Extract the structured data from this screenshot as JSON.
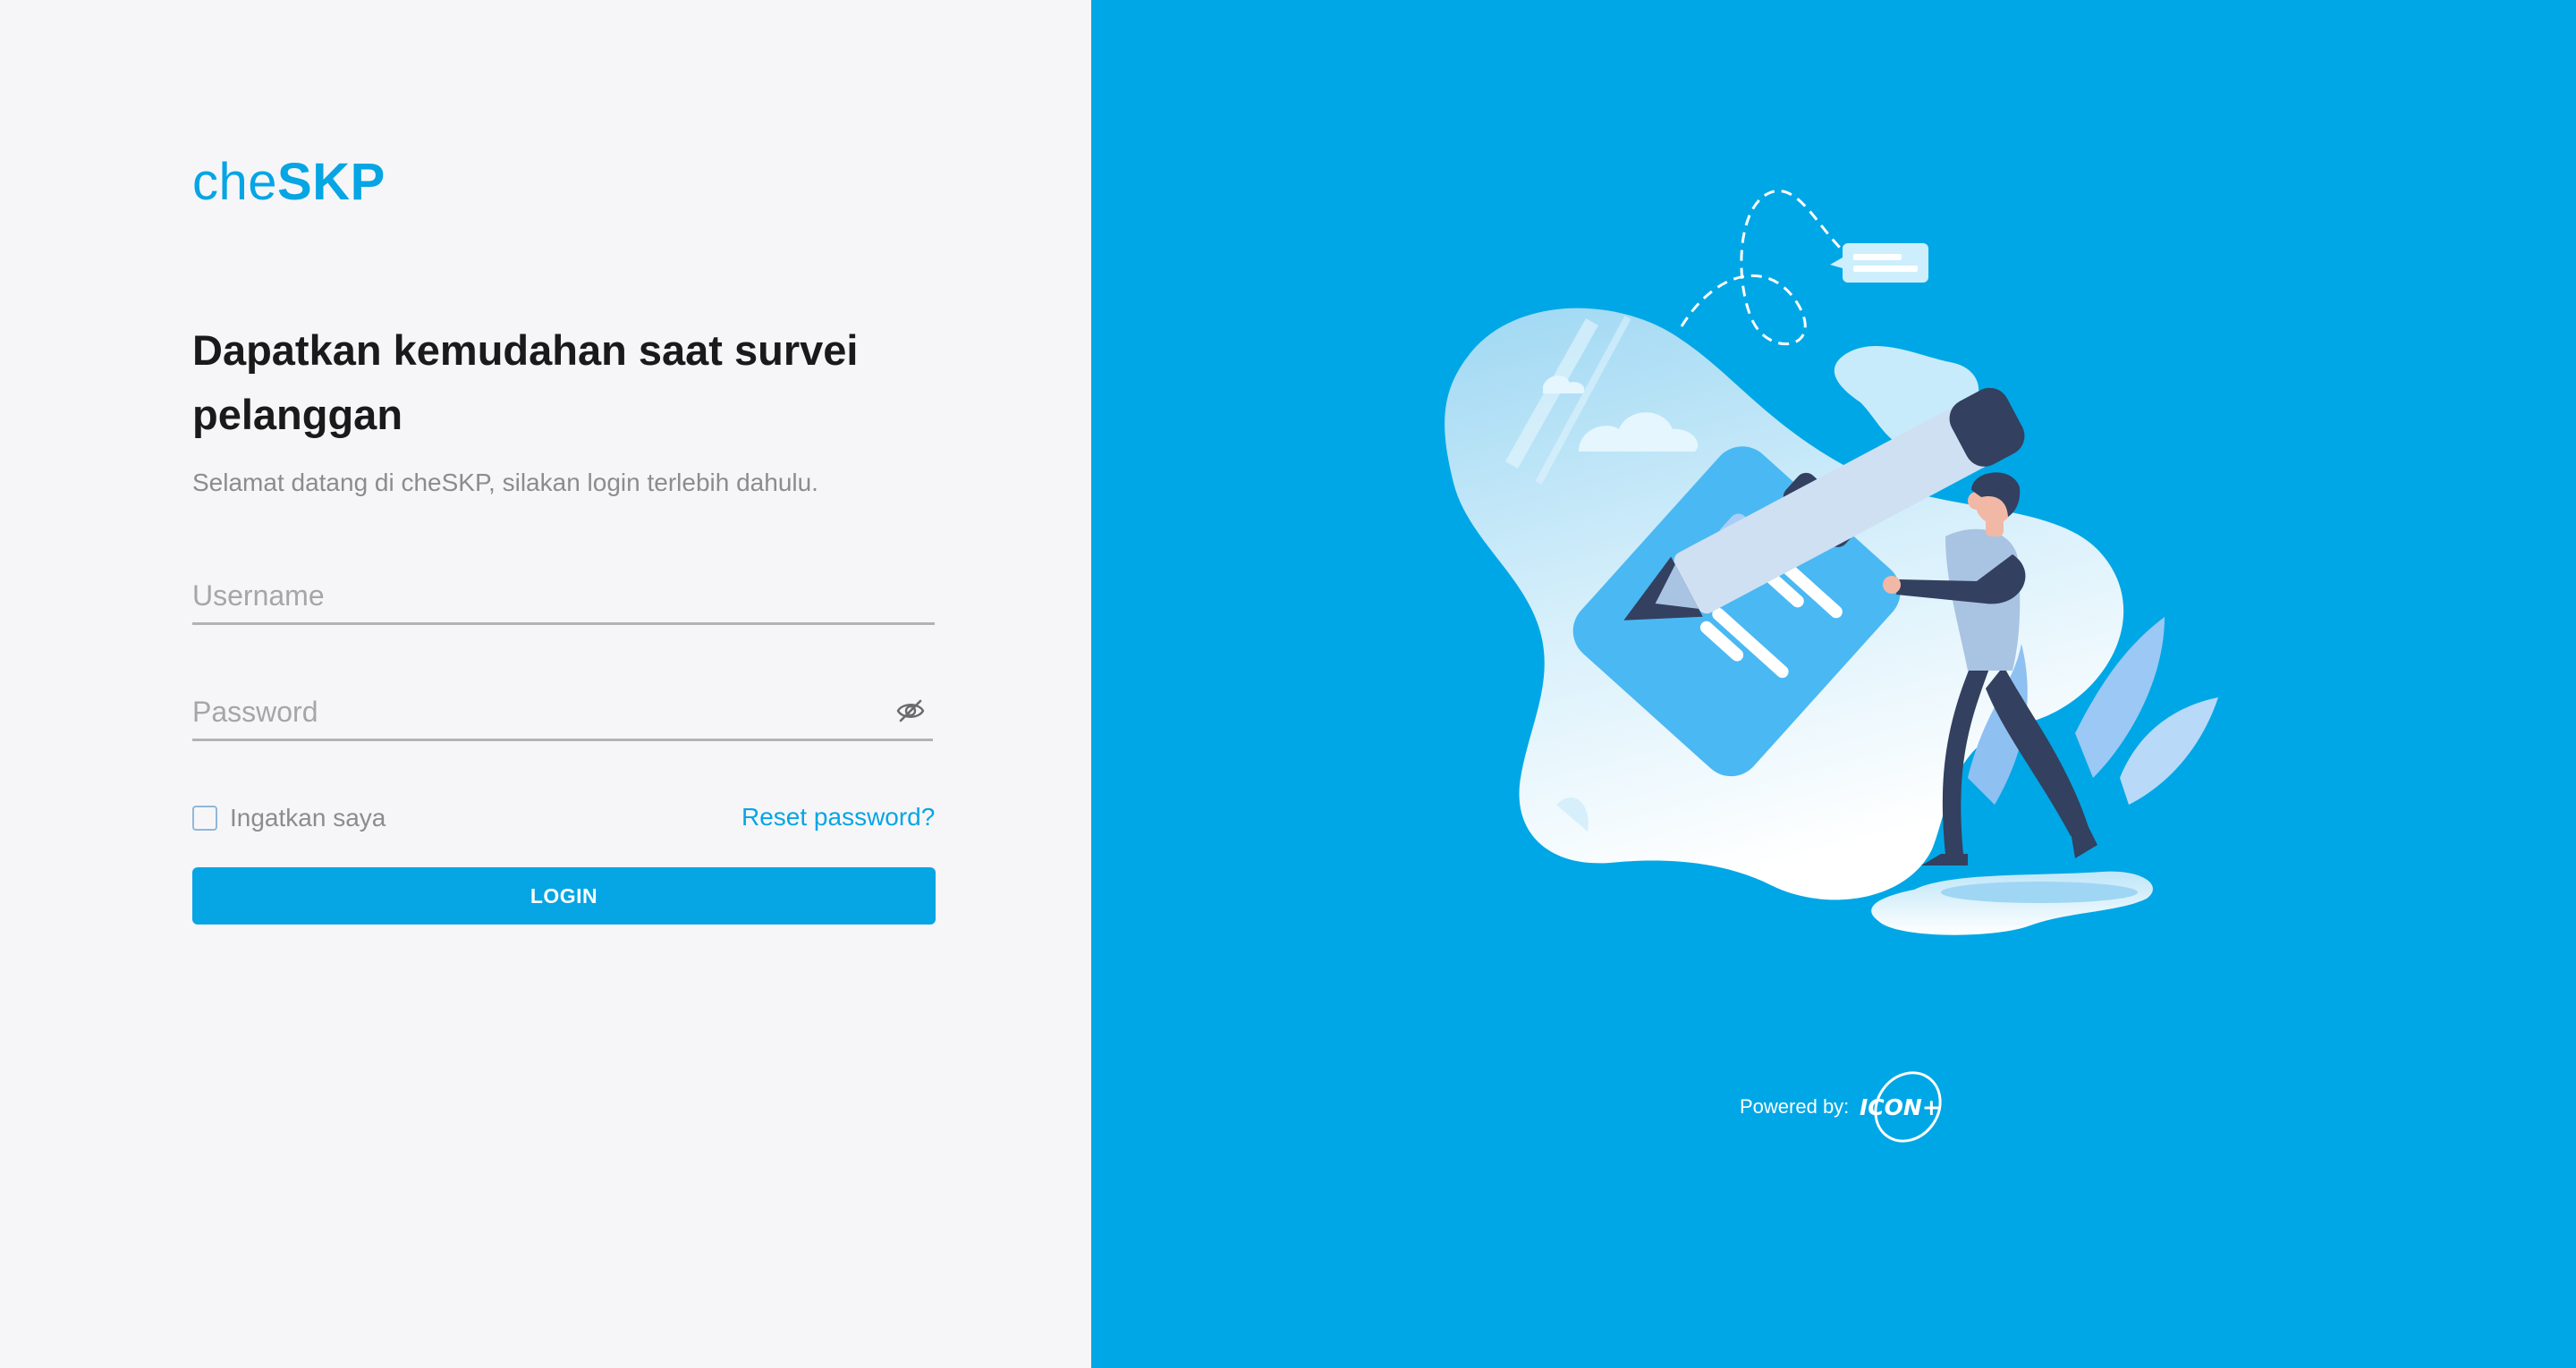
{
  "brand": {
    "logo_prefix": "che",
    "logo_strong": "SKP"
  },
  "login": {
    "headline": "Dapatkan kemudahan saat survei pelanggan",
    "subtitle": "Selamat datang di cheSKP, silakan login terlebih dahulu.",
    "username": {
      "value": "",
      "placeholder": "Username"
    },
    "password": {
      "value": "",
      "placeholder": "Password"
    },
    "remember_label": "Ingatkan saya",
    "remember_checked": false,
    "reset_label": "Reset password?",
    "login_label": "LOGIN"
  },
  "footer": {
    "powered_label": "Powered by:",
    "powered_logo": "ICON+"
  },
  "icons": {
    "password_toggle": "eye-slash-icon",
    "illustration": "person-with-giant-pencil-and-checklist"
  },
  "colors": {
    "accent": "#06a5e4",
    "right_panel_bg": "#00a7e6",
    "left_panel_bg": "#f6f6f9",
    "headline": "#1a1a1a",
    "muted_text": "#8c8c8c"
  }
}
